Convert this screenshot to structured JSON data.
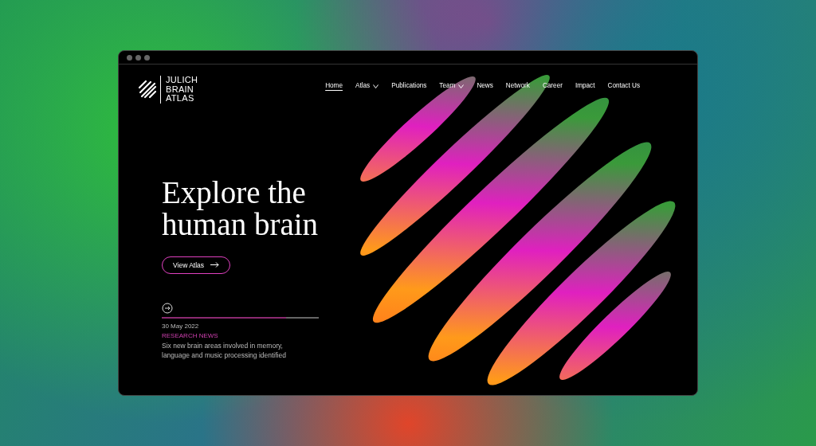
{
  "logo": {
    "lines": [
      "JULICH",
      "BRAIN",
      "ATLAS"
    ]
  },
  "nav": [
    {
      "label": "Home",
      "selected": true,
      "has_menu": false
    },
    {
      "label": "Atlas",
      "selected": false,
      "has_menu": true
    },
    {
      "label": "Publications",
      "selected": false,
      "has_menu": false
    },
    {
      "label": "Team",
      "selected": false,
      "has_menu": true
    },
    {
      "label": "News",
      "selected": false,
      "has_menu": false
    },
    {
      "label": "Network",
      "selected": false,
      "has_menu": false
    },
    {
      "label": "Career",
      "selected": false,
      "has_menu": false
    },
    {
      "label": "Impact",
      "selected": false,
      "has_menu": false
    },
    {
      "label": "Contact Us",
      "selected": false,
      "has_menu": false
    }
  ],
  "hero": {
    "title_lines": [
      "Explore the",
      "human brain"
    ],
    "button": "View Atlas"
  },
  "news": {
    "level": 0.79,
    "date": "30 May 2022",
    "category": "RESEARCH NEWS",
    "text": "Six new brain areas involved in memory, language and music processing identified"
  }
}
